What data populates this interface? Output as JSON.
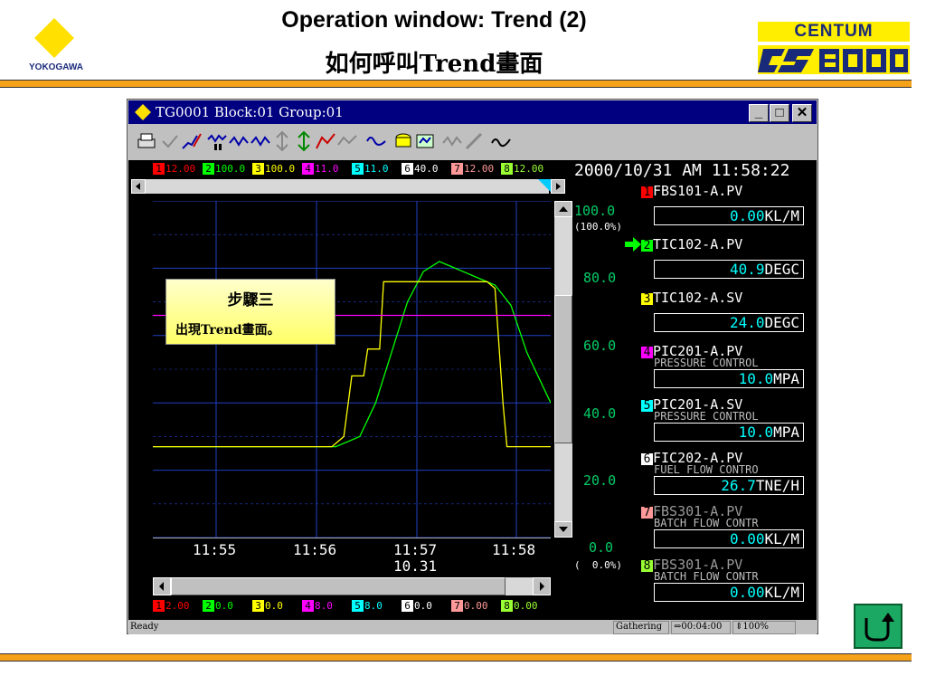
{
  "header": {
    "title_line1": "Operation window: Trend (2)",
    "title_line2": "如何呼叫Trend畫面",
    "left_logo_text": "YOKOGAWA",
    "right_logo_text": "CENTUM",
    "right_logo_mark": "CS3000"
  },
  "window": {
    "title": "TG0001 Block:01 Group:01",
    "minimize": "_",
    "maximize": "□",
    "close": "✕"
  },
  "timestamp": "2000/10/31  AM 11:58:22",
  "top_scale_labels": [
    "12.00",
    "100.0",
    "100.0",
    "11.0",
    "11.0",
    "40.0",
    "12.00",
    "12.00"
  ],
  "bottom_scale_labels": [
    "2.00",
    "0.0",
    "0.0",
    "8.0",
    "8.0",
    "0.0",
    "0.00",
    "0.00"
  ],
  "pen_numbers": [
    "1",
    "2",
    "3",
    "4",
    "5",
    "6",
    "7",
    "8"
  ],
  "pen_colors": [
    "#ff0000",
    "#00ff00",
    "#ffff00",
    "#ff00ff",
    "#00ffff",
    "#ffffff",
    "#ff9999",
    "#99ff33"
  ],
  "y_axis": {
    "labels": [
      "100.0",
      "80.0",
      "60.0",
      "40.0",
      "20.0",
      "0.0"
    ],
    "top_pct": "(100.0%)",
    "bottom_pct": "(  0.0%)"
  },
  "x_axis": {
    "labels": [
      "11:55",
      "11:56",
      "11:57",
      "11:58"
    ],
    "date": "10.31"
  },
  "tags": [
    {
      "name": "FBS101-A.PV",
      "desc": "",
      "value": "0.00",
      "unit": "KL/M"
    },
    {
      "name": "TIC102-A.PV",
      "desc": "",
      "value": "40.9",
      "unit": "DEGC"
    },
    {
      "name": "TIC102-A.SV",
      "desc": "",
      "value": "24.0",
      "unit": "DEGC"
    },
    {
      "name": "PIC201-A.PV",
      "desc": "PRESSURE CONTROL",
      "value": "10.0",
      "unit": "MPA"
    },
    {
      "name": "PIC201-A.SV",
      "desc": "PRESSURE CONTROL",
      "value": "10.0",
      "unit": "MPA"
    },
    {
      "name": "FIC202-A.PV",
      "desc": "FUEL FLOW CONTRO",
      "value": "26.7",
      "unit": "TNE/H"
    },
    {
      "name": "FBS301-A.PV",
      "desc": "BATCH FLOW CONTR",
      "value": "0.00",
      "unit": "KL/M"
    },
    {
      "name": "FBS301-A.PV",
      "desc": "BATCH FLOW CONTR",
      "value": "0.00",
      "unit": "KL/M"
    }
  ],
  "callout": {
    "title": "步驟三",
    "body": "出現Trend畫面。"
  },
  "status": {
    "left": "Ready",
    "mode": "Gathering",
    "span": "00:04:00",
    "zoom": "100%"
  },
  "chart_data": {
    "type": "line",
    "x": [
      "11:54.4",
      "11:55",
      "11:56",
      "11:57",
      "11:58",
      "11:58.2"
    ],
    "ylim": [
      0,
      100
    ],
    "series": [
      {
        "name": "TIC102-A.PV",
        "color": "#00ff00",
        "points": [
          [
            0.0,
            27
          ],
          [
            0.46,
            27
          ],
          [
            0.52,
            30
          ],
          [
            0.56,
            40
          ],
          [
            0.6,
            55
          ],
          [
            0.64,
            70
          ],
          [
            0.68,
            79
          ],
          [
            0.72,
            82
          ],
          [
            0.76,
            80
          ],
          [
            0.82,
            77
          ],
          [
            0.86,
            75
          ],
          [
            0.9,
            69
          ],
          [
            0.94,
            55
          ],
          [
            1.0,
            40
          ]
        ]
      },
      {
        "name": "TIC102-A.SV",
        "color": "#ffff00",
        "points": [
          [
            0.0,
            27
          ],
          [
            0.45,
            27
          ],
          [
            0.48,
            30
          ],
          [
            0.5,
            48
          ],
          [
            0.53,
            48
          ],
          [
            0.54,
            56
          ],
          [
            0.57,
            56
          ],
          [
            0.58,
            76
          ],
          [
            0.84,
            76
          ],
          [
            0.86,
            74
          ],
          [
            0.88,
            40
          ],
          [
            0.89,
            27
          ],
          [
            1.0,
            27
          ]
        ]
      },
      {
        "name": "PIC201-A.PV",
        "color": "#ff00ff",
        "points": [
          [
            0.0,
            66
          ],
          [
            1.0,
            66
          ]
        ]
      }
    ]
  }
}
